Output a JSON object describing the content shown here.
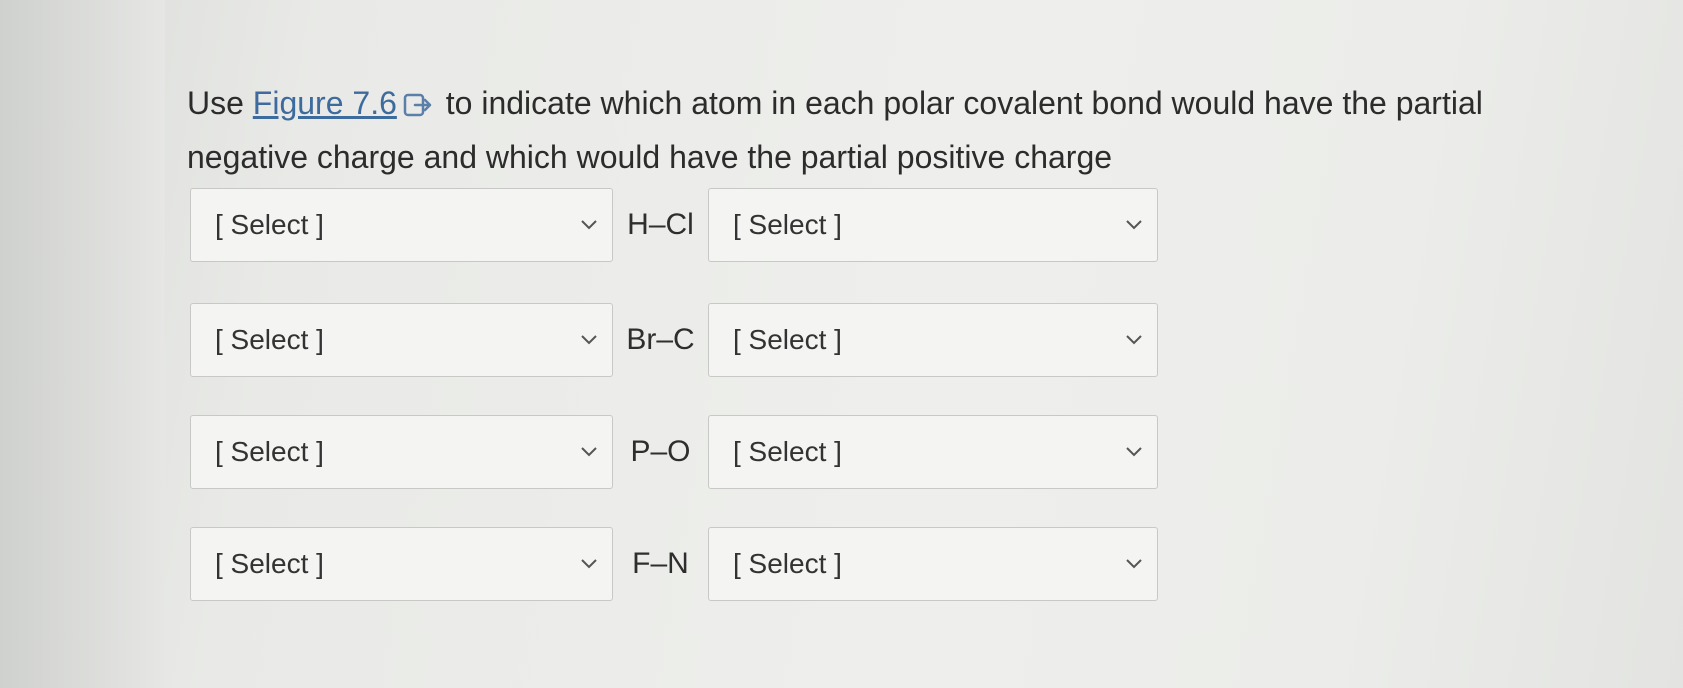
{
  "question": {
    "prefix": "Use ",
    "link_text": "Figure 7.6",
    "suffix": " to indicate which atom in each polar covalent bond would have the partial negative charge and which would have the partial positive charge"
  },
  "rows": [
    {
      "left_select": "[ Select ]",
      "bond": "H–Cl",
      "right_select": "[ Select ]"
    },
    {
      "left_select": "[ Select ]",
      "bond": "Br–C",
      "right_select": "[ Select ]"
    },
    {
      "left_select": "[ Select ]",
      "bond": "P–O",
      "right_select": "[ Select ]"
    },
    {
      "left_select": "[ Select ]",
      "bond": "F–N",
      "right_select": "[ Select ]"
    }
  ],
  "icons": {
    "link_icon": "external-link-icon",
    "dropdown_icon": "chevron-down-icon"
  },
  "colors": {
    "link": "#3d6b9e",
    "text": "#2c2c2c"
  }
}
